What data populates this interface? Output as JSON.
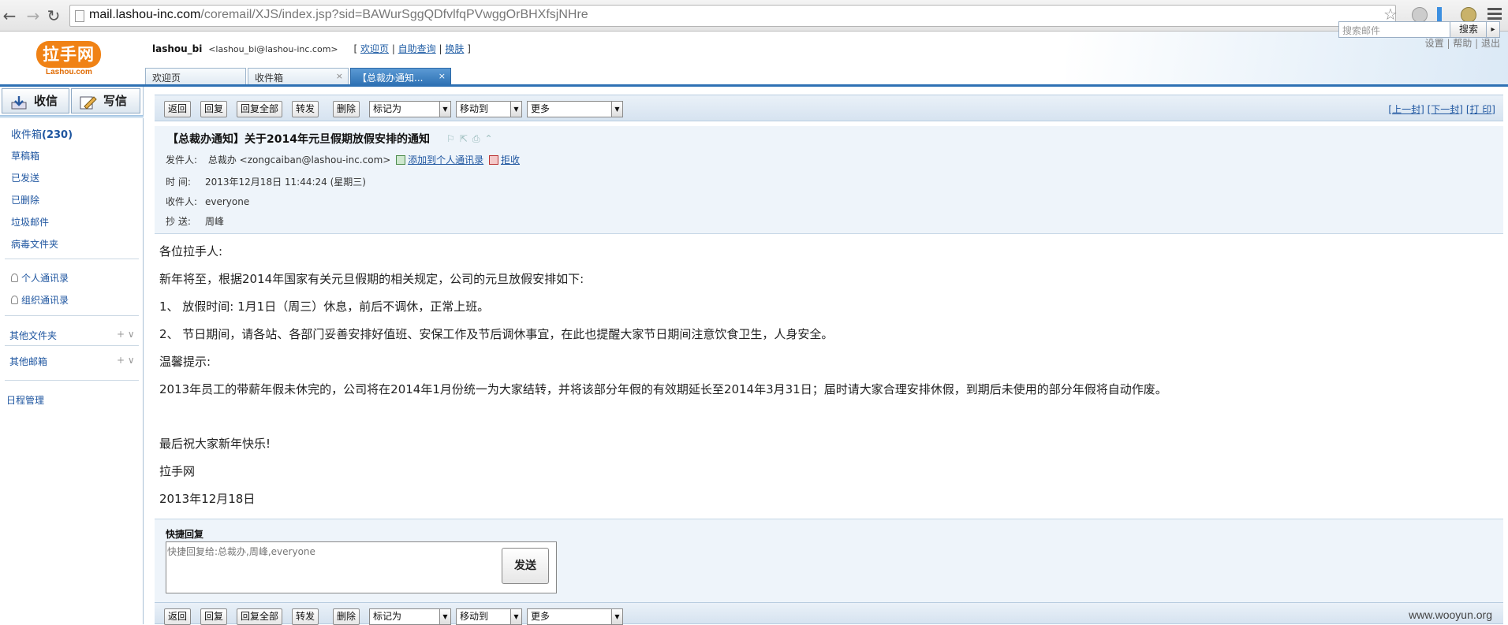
{
  "browser": {
    "url_host": "mail.lashou-inc.com",
    "url_path": "/coremail/XJS/index.jsp?sid=BAWurSggQDfvlfqPVwggOrBHXfsjNHre"
  },
  "header": {
    "logo_text": "拉手网",
    "logo_sub": "Lashou.com",
    "user_name": "lashou_bi",
    "user_email": "<lashou_bi@lashou-inc.com>",
    "links_open": "[",
    "link_welcome": "欢迎页",
    "link_selfquery": "自助查询",
    "link_skin": "换肤",
    "links_close": "]",
    "top_settings": "设置",
    "top_help": "帮助",
    "top_logout": "退出",
    "search_placeholder": "搜索邮件",
    "search_button": "搜索"
  },
  "tabs": [
    {
      "label": "欢迎页"
    },
    {
      "label": "收件箱",
      "close": "×"
    },
    {
      "label": "【总裁办通知...",
      "close": "×"
    }
  ],
  "sidebar": {
    "receive_button": "收信",
    "compose_button": "写信",
    "inbox_label": "收件箱",
    "inbox_count": "(230)",
    "folders": [
      "草稿箱",
      "已发送",
      "已删除",
      "垃圾邮件",
      "病毒文件夹"
    ],
    "contacts_personal": "个人通讯录",
    "contacts_org": "组织通讯录",
    "other_folders": "其他文件夹",
    "other_mailbox": "其他邮箱",
    "plus_toggle": "+ ∨",
    "schedule": "日程管理"
  },
  "toolbar": {
    "back": "返回",
    "reply": "回复",
    "reply_all": "回复全部",
    "forward": "转发",
    "delete": "删除",
    "mark_as": "标记为",
    "move_to": "移动到",
    "more": "更多",
    "prev": "[上一封]",
    "next": "[下一封]",
    "print": "[打 印]"
  },
  "mail": {
    "subject": "【总裁办通知】关于2014年元旦假期放假安排的通知",
    "sender_label": "发件人:",
    "sender_name": "总裁办",
    "sender_email": "<zongcaiban@lashou-inc.com>",
    "add_contact": "添加到个人通讯录",
    "reject": "拒收",
    "time_label": "时 间:",
    "time_value": "2013年12月18日 11:44:24 (星期三)",
    "to_label": "收件人:",
    "to_value": "everyone",
    "cc_label": "抄 送:",
    "cc_value": "周峰"
  },
  "body": {
    "lines": [
      "各位拉手人:",
      "新年将至，根据2014年国家有关元旦假期的相关规定，公司的元旦放假安排如下:",
      "1、  放假时间: 1月1日（周三）休息，前后不调休，正常上班。",
      "2、  节日期间，请各站、各部门妥善安排好值班、安保工作及节后调休事宜，在此也提醒大家节日期间注意饮食卫生，人身安全。",
      "温馨提示:",
      "2013年员工的带薪年假未休完的，公司将在2014年1月份统一为大家结转，并将该部分年假的有效期延长至2014年3月31日；届时请大家合理安排休假，到期后未使用的部分年假将自动作废。",
      "最后祝大家新年快乐!",
      "拉手网",
      "2013年12月18日"
    ]
  },
  "quick_reply": {
    "title": "快捷回复",
    "placeholder": "快捷回复给:总裁办,周峰,everyone",
    "send": "发送"
  },
  "watermark": "www.wooyun.org"
}
